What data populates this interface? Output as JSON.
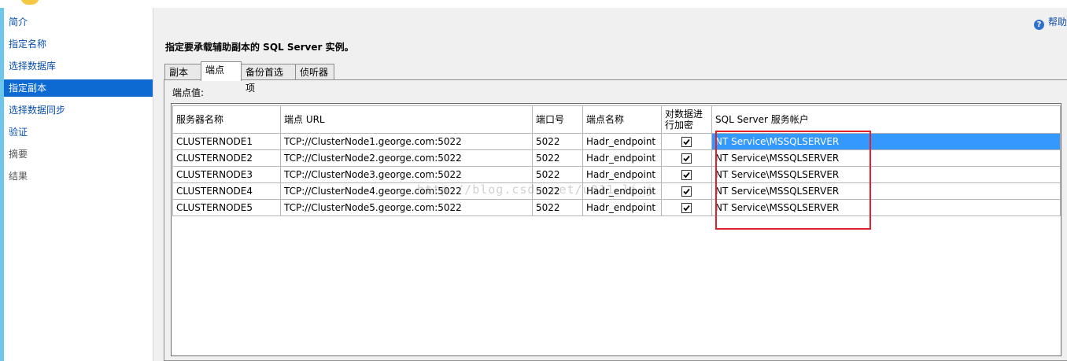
{
  "sidebar": {
    "items": [
      {
        "label": "简介"
      },
      {
        "label": "指定名称"
      },
      {
        "label": "选择数据库"
      },
      {
        "label": "指定副本"
      },
      {
        "label": "选择数据同步"
      },
      {
        "label": "验证"
      },
      {
        "label": "摘要"
      },
      {
        "label": "结果"
      }
    ],
    "selected_index": 3
  },
  "help": {
    "label": "帮助",
    "icon": "help-icon"
  },
  "instruction": "指定要承载辅助副本的 SQL Server 实例。",
  "tabs": [
    {
      "label": "副本"
    },
    {
      "label": "端点"
    },
    {
      "label": "备份首选项"
    },
    {
      "label": "侦听器"
    }
  ],
  "active_tab": 1,
  "endpoint_values_label": "端点值:",
  "grid": {
    "columns": [
      "服务器名称",
      "端点 URL",
      "端口号",
      "端点名称",
      "对数据进行加密",
      "SQL Server 服务帐户"
    ],
    "rows": [
      {
        "server": "CLUSTERNODE1",
        "url": "TCP://ClusterNode1.george.com:5022",
        "port": "5022",
        "endpoint": "Hadr_endpoint",
        "encrypt": true,
        "account": "NT Service\\MSSQLSERVER"
      },
      {
        "server": "CLUSTERNODE2",
        "url": "TCP://ClusterNode2.george.com:5022",
        "port": "5022",
        "endpoint": "Hadr_endpoint",
        "encrypt": true,
        "account": "NT Service\\MSSQLSERVER"
      },
      {
        "server": "CLUSTERNODE3",
        "url": "TCP://ClusterNode3.george.com:5022",
        "port": "5022",
        "endpoint": "Hadr_endpoint",
        "encrypt": true,
        "account": "NT Service\\MSSQLSERVER"
      },
      {
        "server": "CLUSTERNODE4",
        "url": "TCP://ClusterNode4.george.com:5022",
        "port": "5022",
        "endpoint": "Hadr_endpoint",
        "encrypt": true,
        "account": "NT Service\\MSSQLSERVER"
      },
      {
        "server": "CLUSTERNODE5",
        "url": "TCP://ClusterNode5.george.com:5022",
        "port": "5022",
        "endpoint": "Hadr_endpoint",
        "encrypt": true,
        "account": "NT Service\\MSSQLSERVER"
      }
    ],
    "selected_row": 0
  },
  "watermark": "http://blog.csdn.net/u011_li_j",
  "colors": {
    "sidebar_link": "#0b4fae",
    "sidebar_selected_bg": "#0e6ad3",
    "row_selected_bg": "#3399ff",
    "annotation_box": "#e0202a",
    "window_bg": "#f0f0f0"
  }
}
